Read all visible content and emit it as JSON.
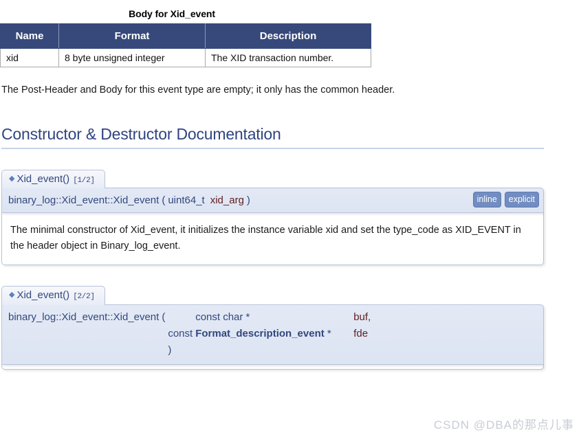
{
  "body_table": {
    "caption": "Body for Xid_event",
    "headers": [
      "Name",
      "Format",
      "Description"
    ],
    "rows": [
      [
        "xid",
        "8 byte unsigned integer",
        "The XID transaction number."
      ]
    ],
    "header_bg": "#36497a",
    "header_fg": "#ffffff"
  },
  "intro_paragraph": "The Post-Header and Body for this event type are empty; it only has the common header.",
  "section": {
    "heading": "Constructor & Destructor Documentation",
    "heading_color": "#2f4480"
  },
  "members": [
    {
      "title": "Xid_event()",
      "overload": "[1/2]",
      "bullet": "◆",
      "signature": {
        "qualified_name": "binary_log::Xid_event::Xid_event",
        "open_paren": "(",
        "close_paren": ")",
        "params": [
          {
            "type": "uint64_t",
            "name": "xid_arg",
            "trailing": ""
          }
        ]
      },
      "labels": [
        "inline",
        "explicit"
      ],
      "doc": "The minimal constructor of Xid_event, it initializes the instance variable xid and set the type_code as XID_EVENT in the header object in Binary_log_event."
    },
    {
      "title": "Xid_event()",
      "overload": "[2/2]",
      "bullet": "◆",
      "signature": {
        "qualified_name": "binary_log::Xid_event::Xid_event",
        "open_paren": "(",
        "close_paren": ")",
        "params": [
          {
            "keyword": "",
            "type_prefix": "const char *",
            "type_bold": "",
            "type_suffix": "",
            "name": "buf,",
            "trailing": ""
          },
          {
            "keyword": "const",
            "type_prefix": "",
            "type_bold": "Format_description_event",
            "type_suffix": " *",
            "name": "fde",
            "trailing": ""
          }
        ]
      },
      "labels": [],
      "doc": ""
    }
  ],
  "watermark": "CSDN @DBA的那点儿事"
}
